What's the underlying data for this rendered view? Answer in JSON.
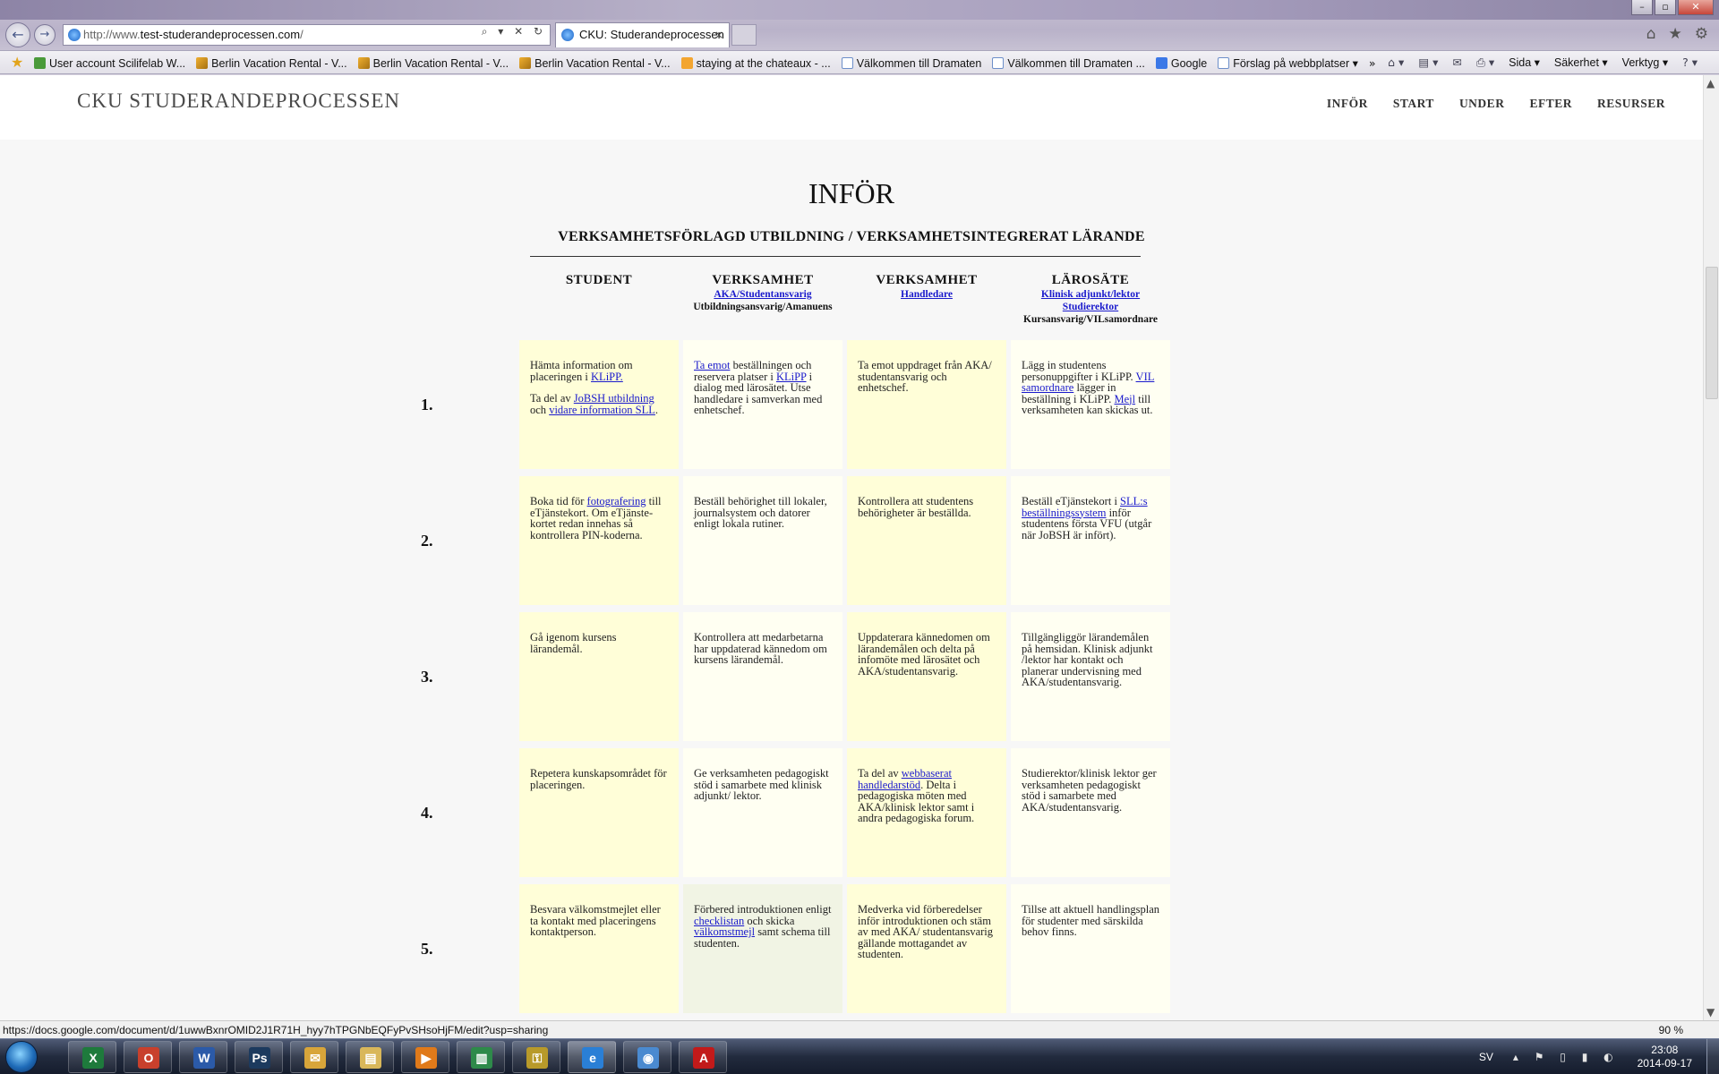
{
  "browser": {
    "url_prefix": "http://www.",
    "url_host": "test-studerandeprocessen.com",
    "url_suffix": "/",
    "tab_title": "CKU: Studerandeprocessen",
    "tab_close": "×",
    "back_glyph": "←",
    "forward_glyph": "→",
    "address_tools": "⌕ ▾ ✕ ↻",
    "right_icons": [
      "⌂",
      "★",
      "⚙"
    ],
    "window_controls": [
      "–",
      "▫",
      "✕"
    ]
  },
  "favorites": {
    "star": "★",
    "items": [
      {
        "label": "User account  Scilifelab W...",
        "icon": "green"
      },
      {
        "label": "Berlin Vacation Rental - V...",
        "icon": "house"
      },
      {
        "label": "Berlin Vacation Rental - V...",
        "icon": "house"
      },
      {
        "label": "Berlin Vacation Rental - V...",
        "icon": "house"
      },
      {
        "label": "staying at the chateaux - ...",
        "icon": "m"
      },
      {
        "label": "Välkommen till Dramaten",
        "icon": "page"
      },
      {
        "label": "Välkommen till Dramaten ...",
        "icon": "page"
      },
      {
        "label": "Google",
        "icon": "goog"
      },
      {
        "label": "Förslag på webbplatser ▾",
        "icon": "page"
      }
    ],
    "overflow": "»",
    "commands": [
      "Sida ▾",
      "Säkerhet ▾",
      "Verktyg ▾"
    ],
    "command_icons": [
      "⌂ ▾",
      "▤ ▾",
      "✉",
      "⎙ ▾",
      "? ▾"
    ]
  },
  "site": {
    "title": "CKU STUDERANDEPROCESSEN",
    "nav": [
      "INFÖR",
      "START",
      "UNDER",
      "EFTER",
      "RESURSER"
    ]
  },
  "page": {
    "heading": "INFÖR",
    "subheading": "VERKSAMHETSFÖRLAGD UTBILDNING / VERKSAMHETSINTEGRERAT LÄRANDE",
    "columns": [
      {
        "title": "STUDENT",
        "links": [],
        "role": ""
      },
      {
        "title": "VERKSAMHET",
        "links": [
          "AKA/Studentansvarig"
        ],
        "role": "Utbildningsansvarig/Amanuens"
      },
      {
        "title": "VERKSAMHET",
        "links": [
          "Handledare"
        ],
        "role": ""
      },
      {
        "title": "LÄROSÄTE",
        "links": [
          "Klinisk adjunkt/lektor",
          "Studierektor"
        ],
        "role": "Kursansvarig/VILsamordnare"
      }
    ],
    "rows": [
      {
        "num": "1.",
        "cells": [
          "Hämta information om placeringen i [KLiPP.]||Ta del av [JoBSH utbildning] och [vidare information SLL].",
          "[Ta emot] beställningen och reservera platser i [KLiPP] i dialog med lärosätet. Utse handledare i samverkan med enhetschef.",
          "Ta emot uppdraget från AKA/ studentansvarig och enhetschef.",
          "Lägg in studentens personuppgifter i KLiPP. [VIL samordnare] lägger in beställning i KLiPP. [Mejl] till verksamheten kan skickas ut."
        ]
      },
      {
        "num": "2.",
        "cells": [
          "Boka tid för [fotografering] till eTjänstekort. Om eTjänste-kortet redan innehas så kontrollera PIN-koderna.",
          "Beställ behörighet till lokaler, journalsystem och datorer enligt lokala rutiner.",
          "Kontrollera att studentens behörigheter är beställda.",
          "Beställ eTjänstekort i [SLL:s beställningssystem] inför studentens första VFU (utgår när JoBSH är infört)."
        ]
      },
      {
        "num": "3.",
        "cells": [
          "Gå igenom kursens lärandemål.",
          "Kontrollera att medarbetarna har uppdaterad kännedom om kursens lärandemål.",
          "Uppdaterara kännedomen om lärandemålen och delta på infomöte med lärosätet och AKA/studentansvarig.",
          "Tillgängliggör lärandemålen på hemsidan. Klinisk adjunkt /lektor har kontakt och planerar undervisning med AKA/studentansvarig."
        ]
      },
      {
        "num": "4.",
        "cells": [
          "Repetera kunskapsområdet för placeringen.",
          "Ge verksamheten pedagogiskt stöd i samarbete med klinisk adjunkt/ lektor.",
          "Ta del av [webbaserat handledarstöd]. Delta i pedagogiska möten med AKA/klinisk lektor samt i andra pedagogiska forum.",
          "Studierektor/klinisk lektor ger verksamheten pedagogiskt stöd i samarbete med AKA/studentansvarig."
        ]
      },
      {
        "num": "5.",
        "cells": [
          "Besvara välkomstmejlet eller ta kontakt med placeringens kontaktperson.",
          "Förbered introduktionen enligt [checklistan] och skicka [välkomstmejl] samt schema  till studenten.",
          "Medverka vid förberedelser inför introduktionen och stäm av med AKA/ studentansvarig gällande mottagandet av studenten.",
          "Tillse att aktuell handlingsplan för studenter med särskilda behov finns."
        ]
      }
    ]
  },
  "statusbar": {
    "url": "https://docs.google.com/document/d/1uwwBxnrOMID2J1R71H_hyy7hTPGNbEQFyPvSHsoHjFM/edit?usp=sharing",
    "zoom": "90 %"
  },
  "taskbar": {
    "apps": [
      {
        "name": "excel",
        "glyph": "X",
        "color": "#1e7a3c"
      },
      {
        "name": "outlook-app",
        "glyph": "O",
        "color": "#c8402c"
      },
      {
        "name": "word",
        "glyph": "W",
        "color": "#2b5aa8"
      },
      {
        "name": "photoshop",
        "glyph": "Ps",
        "color": "#1c3a5e"
      },
      {
        "name": "mail",
        "glyph": "✉",
        "color": "#d8a53a"
      },
      {
        "name": "explorer",
        "glyph": "▤",
        "color": "#d9b75a"
      },
      {
        "name": "media",
        "glyph": "▶",
        "color": "#e07a1a"
      },
      {
        "name": "stats",
        "glyph": "▥",
        "color": "#2e8a4a"
      },
      {
        "name": "keys",
        "glyph": "⚿",
        "color": "#b89a2a"
      },
      {
        "name": "internet-explorer",
        "glyph": "e",
        "color": "#2a7fd6"
      },
      {
        "name": "network",
        "glyph": "◉",
        "color": "#4a8ad0"
      },
      {
        "name": "acrobat",
        "glyph": "A",
        "color": "#c21a1a"
      }
    ],
    "lang": "SV",
    "tray_icons": "▴ ⚑ ▯ ▮ ◐",
    "time": "23:08",
    "date": "2014-09-17"
  }
}
